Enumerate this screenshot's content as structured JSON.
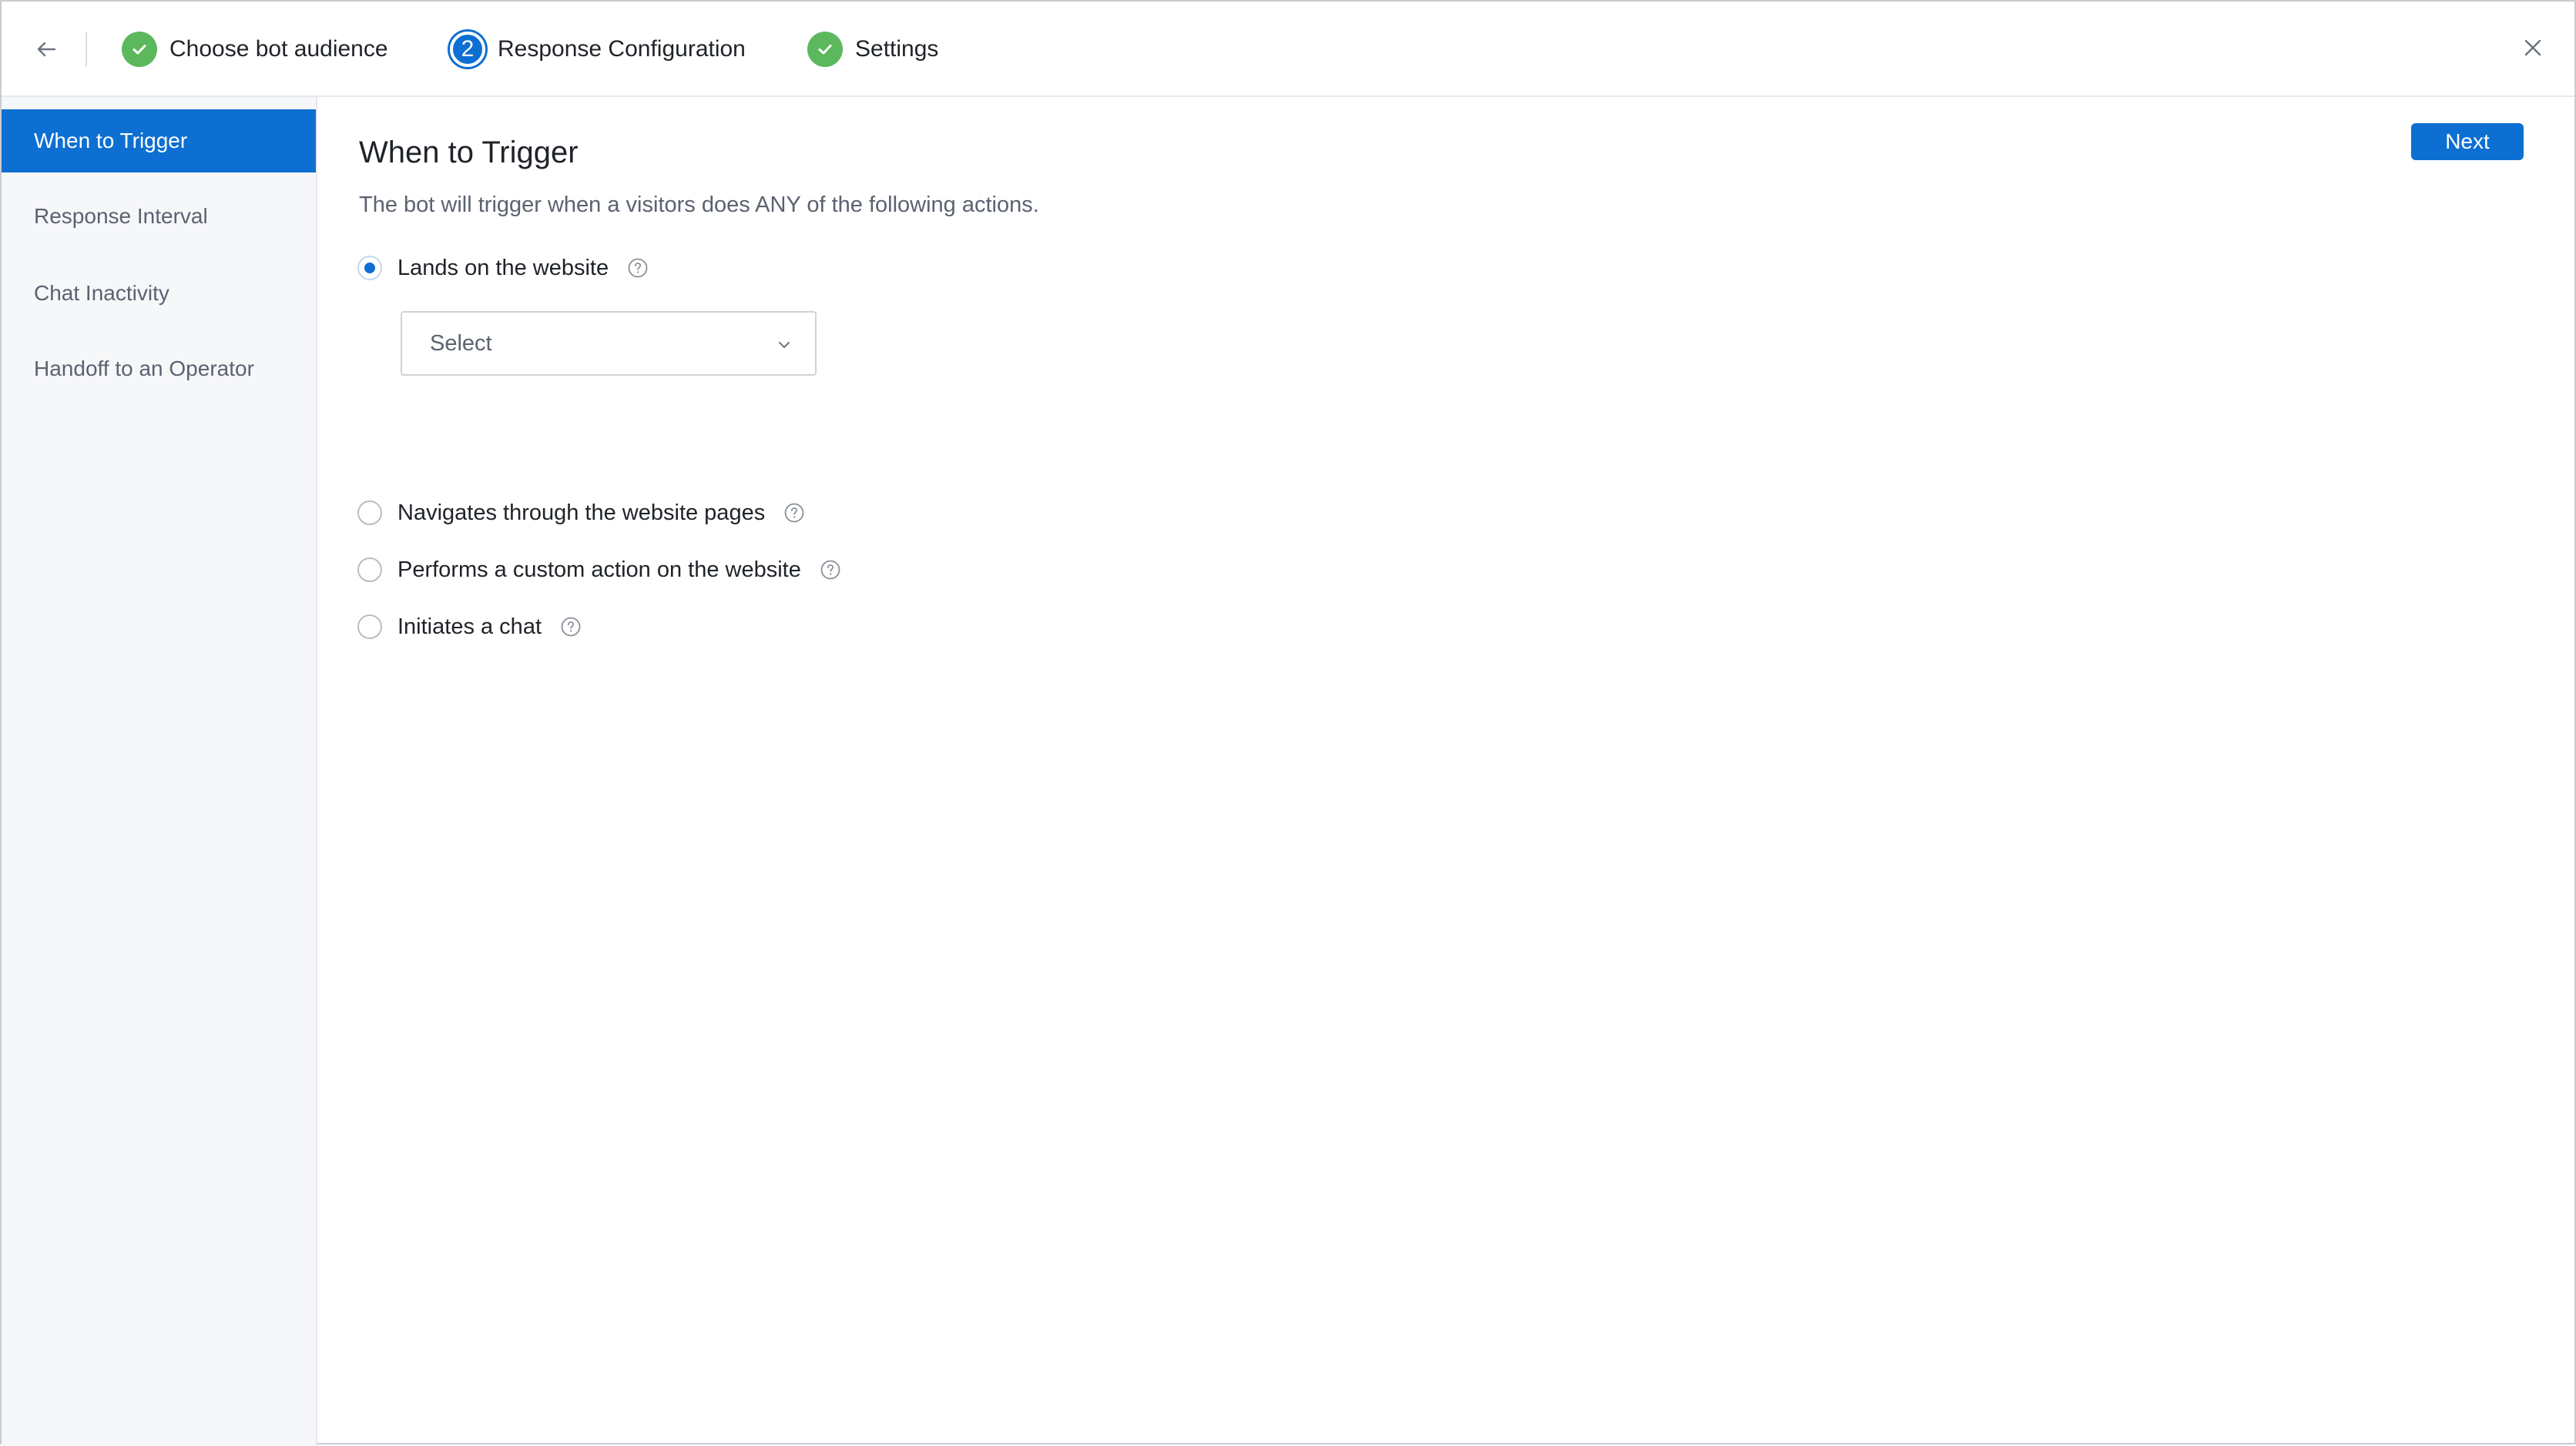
{
  "colors": {
    "accent": "#0d6fd1",
    "step_done": "#5cb85c",
    "sidebar_bg": "#f6f7f9",
    "muted_text": "#5b6270"
  },
  "header": {
    "back_icon": "arrow-left-icon",
    "close_icon": "close-icon",
    "steps": [
      {
        "label": "Choose bot audience",
        "status": "done",
        "icon": "check-circle-icon"
      },
      {
        "label": "Response Configuration",
        "status": "current",
        "number": "2"
      },
      {
        "label": "Settings",
        "status": "done",
        "icon": "check-circle-icon"
      }
    ]
  },
  "sidebar": {
    "items": [
      {
        "label": "When to Trigger",
        "active": true
      },
      {
        "label": "Response Interval",
        "active": false
      },
      {
        "label": "Chat Inactivity",
        "active": false
      },
      {
        "label": "Handoff to an Operator",
        "active": false
      }
    ]
  },
  "main": {
    "next_label": "Next",
    "title": "When to Trigger",
    "description": "The bot will trigger when a visitors does ANY of the following actions.",
    "options": [
      {
        "label": "Lands on the website",
        "selected": true,
        "help_icon": "question-circle-icon"
      },
      {
        "label": "Navigates through the website pages",
        "selected": false,
        "help_icon": "question-circle-icon"
      },
      {
        "label": "Performs a custom action on the website",
        "selected": false,
        "help_icon": "question-circle-icon"
      },
      {
        "label": "Initiates a chat",
        "selected": false,
        "help_icon": "question-circle-icon"
      }
    ],
    "select": {
      "value": "Select",
      "icon": "chevron-down-icon"
    }
  }
}
